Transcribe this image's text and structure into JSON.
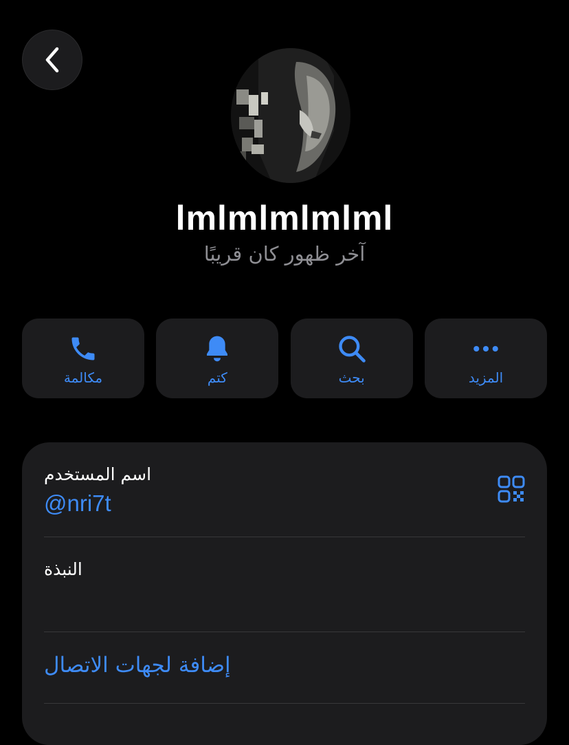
{
  "nav": {
    "back_icon": "chevron-left-icon"
  },
  "profile": {
    "name": "lmlmlmlmlml",
    "status": "آخر ظهور كان قريبًا",
    "avatar": "profile-photo"
  },
  "actions": [
    {
      "label": "مكالمة",
      "icon": "phone-icon"
    },
    {
      "label": "كتم",
      "icon": "bell-icon"
    },
    {
      "label": "بحث",
      "icon": "search-icon"
    },
    {
      "label": "المزيد",
      "icon": "ellipsis-icon"
    }
  ],
  "info": {
    "username_label": "اسم المستخدم",
    "username_value": "@nri7t",
    "qr_icon": "qr-code-icon",
    "bio_label": "النبذة",
    "add_contact_label": "إضافة لجهات الاتصال"
  },
  "colors": {
    "accent": "#3e8bf6",
    "background": "#000000",
    "surface": "#1c1c1e",
    "secondary_text": "#8e8e93"
  }
}
